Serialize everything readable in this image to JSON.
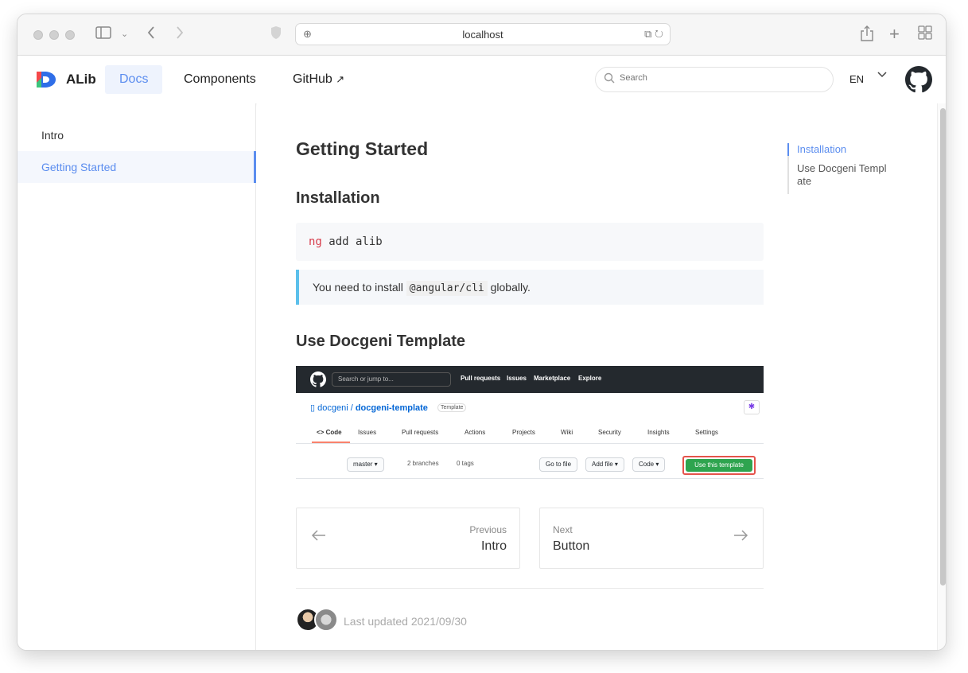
{
  "browser": {
    "url": "localhost",
    "icons": {
      "sidebar": "sidebar-toggle-icon",
      "back": "back-arrow-icon",
      "forward": "forward-arrow-icon",
      "shield": "shield-icon",
      "translate": "translate-icon",
      "reload": "reload-icon",
      "share": "share-icon",
      "new_tab": "plus-icon",
      "tabs": "tab-grid-icon"
    }
  },
  "header": {
    "brand": "ALib",
    "nav": [
      {
        "label": "Docs",
        "active": true
      },
      {
        "label": "Components",
        "active": false
      },
      {
        "label": "GitHub",
        "active": false
      }
    ],
    "search_placeholder": "Search",
    "language": "EN",
    "accent": "#5b8def"
  },
  "sidebar": {
    "items": [
      {
        "label": "Intro",
        "active": false
      },
      {
        "label": "Getting Started",
        "active": true
      }
    ]
  },
  "main": {
    "title": "Getting Started",
    "installation_heading": "Installation",
    "code_keyword": "ng",
    "code_rest": " add alib",
    "note_before": "You need to install ",
    "note_code": "@angular/cli",
    "note_after": " globally.",
    "template_heading": "Use Docgeni Template",
    "screenshot": {
      "search": "Search or jump to...",
      "links": [
        "Pull requests",
        "Issues",
        "Marketplace",
        "Explore"
      ],
      "owner": "docgeni",
      "repo": "docgeni-template",
      "badge": "Template",
      "tabs": [
        "<> Code",
        "Issues",
        "Pull requests",
        "Actions",
        "Projects",
        "Wiki",
        "Security",
        "Insights",
        "Settings"
      ],
      "branch": "master ▾",
      "branches": "2 branches",
      "tags": "0 tags",
      "go_to_file": "Go to file",
      "add_file": "Add file ▾",
      "code": "Code ▾",
      "use_template": "Use this template"
    },
    "pager": {
      "previous_label": "Previous",
      "previous_title": "Intro",
      "next_label": "Next",
      "next_title": "Button"
    },
    "last_updated": "Last updated 2021/09/30"
  },
  "toc": {
    "items": [
      {
        "label": "Installation",
        "active": true
      },
      {
        "label": "Use Docgeni Templ ate",
        "active": false
      }
    ]
  }
}
